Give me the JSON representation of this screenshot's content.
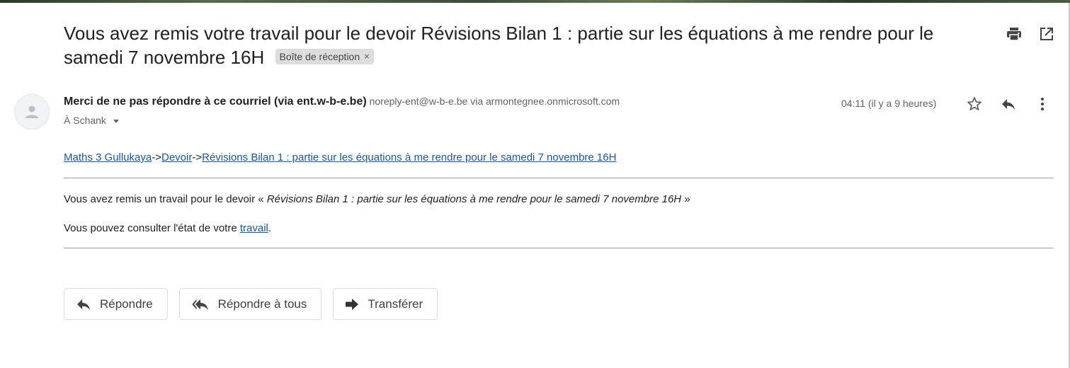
{
  "subject": {
    "text": "Vous avez remis votre travail pour le devoir Révisions Bilan 1 : partie sur les équations à me rendre pour le samedi 7 novembre 16H",
    "label": "Boîte de réception",
    "label_close": "×"
  },
  "top_icons": [
    "print-icon",
    "open-in-new-window-icon"
  ],
  "sender": {
    "name": "Merci de ne pas répondre à ce courriel (via ent.w-b-e.be)",
    "email": "noreply-ent@w-b-e.be",
    "via_word": "via",
    "via_domain": "armontegnee.onmicrosoft.com"
  },
  "recipient": "À Schank",
  "time": "04:11 (il y a 9 heures)",
  "header_actions": [
    "star-icon",
    "reply-icon",
    "more-options-icon"
  ],
  "breadcrumb": {
    "course": "Maths 3 Gullukaya",
    "separator": "->",
    "section": "Devoir",
    "assignment": "Révisions Bilan 1 : partie sur les équations à me rendre pour le samedi 7 novembre 16H"
  },
  "message": {
    "line1_prefix": "Vous avez remis un travail pour le devoir « ",
    "line1_title": "Révisions Bilan 1 : partie sur les équations à me rendre pour le samedi 7 novembre 16H",
    "line1_suffix": " »",
    "line2_prefix": "Vous pouvez consulter l'état de votre ",
    "line2_link": "travail",
    "line2_suffix": "."
  },
  "buttons": {
    "reply": "Répondre",
    "reply_all": "Répondre à tous",
    "forward": "Transférer"
  },
  "colors": {
    "link": "#1a56a8",
    "text": "#202124",
    "muted": "#5f6368"
  }
}
